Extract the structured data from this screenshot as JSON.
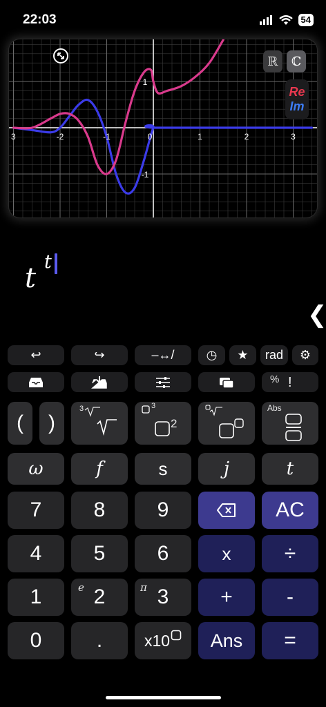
{
  "status": {
    "time": "22:03",
    "battery": "54"
  },
  "graph": {
    "real_toggle": "ℝ",
    "complex_toggle": "ℂ",
    "legend_re": "Re",
    "legend_im": "Im",
    "x_ticks": [
      "3",
      "-2",
      "-1",
      "0",
      "1",
      "2",
      "3"
    ],
    "y_ticks": [
      "1",
      "-1"
    ],
    "re_color": "#d93a8c",
    "im_color": "#3b3be8"
  },
  "chart_data": {
    "type": "line",
    "series": [
      {
        "name": "Re",
        "x": [
          -3.0,
          -2.6,
          -2.2,
          -2.0,
          -1.8,
          -1.6,
          -1.4,
          -1.2,
          -1.0,
          -0.8,
          -0.6,
          -0.4,
          -0.2,
          -0.05,
          0.0,
          0.1,
          0.3,
          0.6,
          0.9,
          1.2,
          1.5
        ],
        "y": [
          0.0,
          0.0,
          0.2,
          0.3,
          0.3,
          0.15,
          -0.2,
          -0.8,
          -1.0,
          -0.7,
          0.1,
          0.8,
          1.2,
          1.25,
          1.0,
          0.75,
          0.8,
          0.9,
          1.1,
          1.4,
          1.9
        ]
      },
      {
        "name": "Im",
        "x": [
          -3.0,
          -2.6,
          -2.2,
          -2.0,
          -1.8,
          -1.6,
          -1.4,
          -1.2,
          -1.0,
          -0.8,
          -0.6,
          -0.4,
          -0.2,
          0.0,
          0.1,
          3.4
        ],
        "y": [
          0.0,
          -0.05,
          -0.1,
          0.0,
          0.25,
          0.5,
          0.6,
          0.35,
          -0.2,
          -1.0,
          -1.4,
          -1.3,
          -0.7,
          0.0,
          0.0,
          0.0
        ]
      }
    ],
    "xlim": [
      -3.0,
      3.4
    ],
    "ylim": [
      -1.8,
      1.9
    ],
    "grid": true
  },
  "expression": {
    "base": "t",
    "exponent": "t"
  },
  "collapse_glyph": "❮",
  "keys": {
    "undo": "↩",
    "redo": "↪",
    "arrows": "–↔/",
    "history": "◷",
    "favorites": "★",
    "angle_mode": "rad",
    "settings": "⚙",
    "percent": "%",
    "factorial": "!",
    "lparen": "(",
    "rparen": ")",
    "root_index": "3",
    "power_exp": "3",
    "power_2": "2",
    "abs": "Abs",
    "omega": "ω",
    "f": "f",
    "s": "s",
    "j": "j",
    "t": "t",
    "k7": "7",
    "k8": "8",
    "k9": "9",
    "ac": "AC",
    "k4": "4",
    "k5": "5",
    "k6": "6",
    "times": "x",
    "divide": "÷",
    "k1": "1",
    "k2": "2",
    "k3": "3",
    "plus": "+",
    "minus": "-",
    "e_const": "e",
    "pi_const": "π",
    "k0": "0",
    "dot": ".",
    "x10": "x10",
    "ans": "Ans",
    "equals": "="
  }
}
